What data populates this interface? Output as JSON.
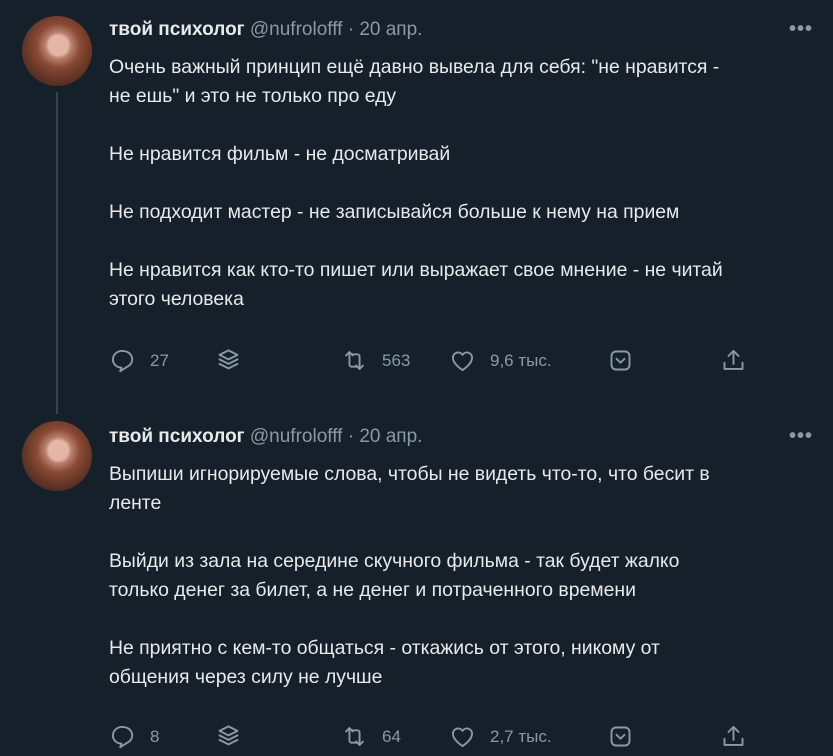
{
  "tweets": [
    {
      "name": "твой психолог",
      "handle": "@nufrolofff",
      "separator": "·",
      "date": "20 апр.",
      "more": "•••",
      "paragraphs": [
        "Очень важный принцип ещё давно вывела для себя: \"не нравится -\nне ешь\" и это не только про еду",
        "Не нравится фильм - не досматривай",
        "Не подходит мастер - не записывайся больше к нему на прием",
        "Не нравится как кто-то пишет или выражает свое мнение - не читай\nэтого человека"
      ],
      "replies": "27",
      "retweets": "563",
      "likes": "9,6 тыс."
    },
    {
      "name": "твой психолог",
      "handle": "@nufrolofff",
      "separator": "·",
      "date": "20 апр.",
      "more": "•••",
      "paragraphs": [
        "Выпиши игнорируемые слова, чтобы не видеть что-то, что бесит в\nленте",
        "Выйди из зала на середине скучного фильма - так будет жалко\nтолько денег за билет, а не денег и потраченного времени",
        "Не приятно с кем-то общаться - откажись от этого, никому от\nобщения через силу не лучше"
      ],
      "replies": "8",
      "retweets": "64",
      "likes": "2,7 тыс."
    }
  ],
  "icons": [
    "reply-icon",
    "stack-icon",
    "retweet-icon",
    "like-icon",
    "bookmark-icon",
    "share-icon"
  ],
  "colors": {
    "background": "#15202b",
    "text": "#e7e9ea",
    "muted": "#8b98a5",
    "line": "#38444d"
  }
}
